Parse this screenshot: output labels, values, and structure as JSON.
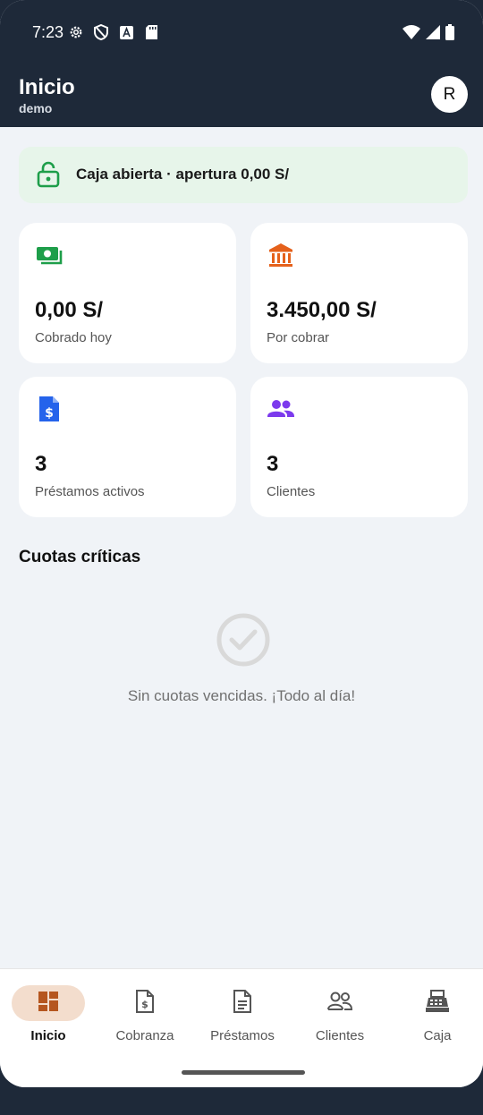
{
  "status_bar": {
    "time": "7:23"
  },
  "app_bar": {
    "title": "Inicio",
    "subtitle": "demo",
    "avatar_letter": "R"
  },
  "banner": {
    "text": "Caja abierta · apertura 0,00 S/",
    "icon": "lock-open-icon",
    "color": "#1e9e4a"
  },
  "cards": [
    {
      "value": "0,00 S/",
      "label": "Cobrado hoy",
      "icon": "cash-icon",
      "color": "#1e9e4a"
    },
    {
      "value": "3.450,00 S/",
      "label": "Por cobrar",
      "icon": "bank-icon",
      "color": "#e5611b"
    },
    {
      "value": "3",
      "label": "Préstamos activos",
      "icon": "invoice-dollar-icon",
      "color": "#2563eb"
    },
    {
      "value": "3",
      "label": "Clientes",
      "icon": "people-icon",
      "color": "#7c3aed"
    }
  ],
  "critical": {
    "title": "Cuotas críticas",
    "empty_text": "Sin cuotas vencidas. ¡Todo al día!"
  },
  "nav": {
    "items": [
      {
        "label": "Inicio",
        "icon": "dashboard-icon",
        "active": true
      },
      {
        "label": "Cobranza",
        "icon": "invoice-dollar-icon",
        "active": false
      },
      {
        "label": "Préstamos",
        "icon": "document-icon",
        "active": false
      },
      {
        "label": "Clientes",
        "icon": "people-icon",
        "active": false
      },
      {
        "label": "Caja",
        "icon": "cash-register-icon",
        "active": false
      }
    ],
    "accent": "#b5561f"
  }
}
